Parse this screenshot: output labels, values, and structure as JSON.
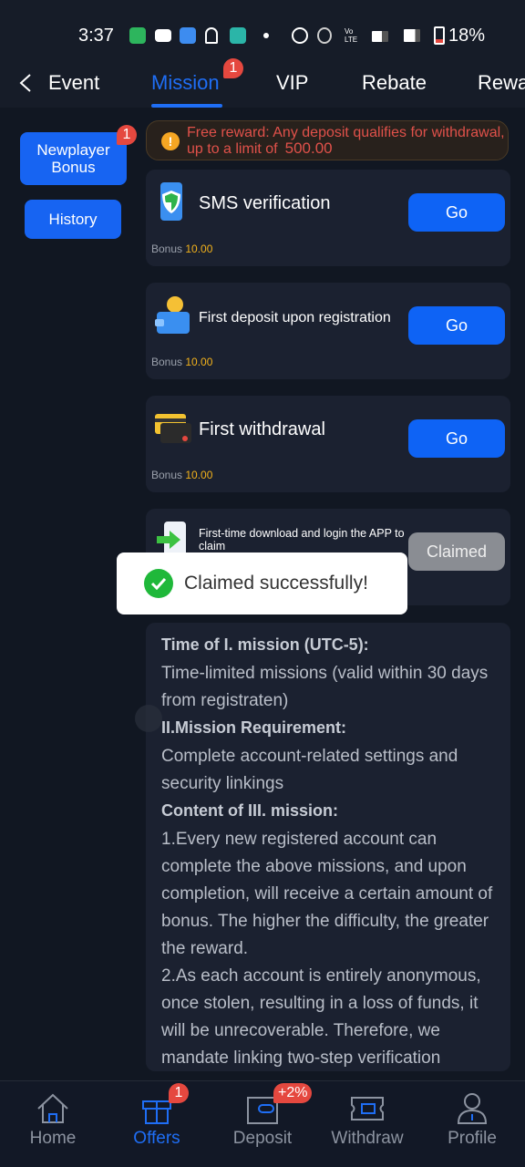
{
  "status_bar": {
    "time": "3:37",
    "battery": "18%",
    "network": "4G"
  },
  "tabs": [
    {
      "label": "Event"
    },
    {
      "label": "Mission",
      "active": true,
      "badge": "1"
    },
    {
      "label": "VIP"
    },
    {
      "label": "Rebate"
    },
    {
      "label": "Rewa"
    }
  ],
  "sidebar": {
    "items": [
      {
        "label": "Newplayer\nBonus",
        "active": true,
        "badge": "1"
      },
      {
        "label": "History"
      }
    ]
  },
  "notice": {
    "text": "Free reward: Any deposit qualifies for withdrawal, up to a limit of",
    "amount": "500.00"
  },
  "missions": [
    {
      "title": "SMS verification",
      "bonus_label": "Bonus",
      "bonus": "10.00",
      "button": "Go",
      "icon": "shield-phone-icon"
    },
    {
      "title": "First deposit upon registration",
      "bonus_label": "Bonus",
      "bonus": "10.00",
      "button": "Go",
      "icon": "wallet-coin-icon"
    },
    {
      "title": "First withdrawal",
      "bonus_label": "Bonus",
      "bonus": "10.00",
      "button": "Go",
      "icon": "cards-icon"
    },
    {
      "title": "First-time download and login the APP to claim",
      "button": "Claimed",
      "icon": "app-download-icon"
    }
  ],
  "toast": {
    "message": "Claimed successfully!"
  },
  "rules": {
    "h1": "Time of I. mission (UTC-5):",
    "p1": "Time-limited missions (valid within 30 days from registraten)",
    "h2": "II.Mission Requirement:",
    "p2": "Complete account-related settings and security linkings",
    "h3": "Content of III. mission:",
    "p3": "1.Every new registered account can complete the above missions, and upon completion, will receive a certain amount of bonus. The higher the difficulty, the greater the reward.",
    "p4": "2.As each account is entirely anonymous, once stolen, resulting in a loss of funds, it will be unrecoverable. Therefore, we mandate linking two-step verification"
  },
  "bottom_nav": [
    {
      "label": "Home"
    },
    {
      "label": "Offers",
      "active": true,
      "badge": "1"
    },
    {
      "label": "Deposit",
      "badge": "+2%"
    },
    {
      "label": "Withdraw"
    },
    {
      "label": "Profile"
    }
  ],
  "colors": {
    "accent": "#1f6ef5",
    "button": "#0e63f5",
    "badge": "#e5483f",
    "bonus": "#f3b21b",
    "notice_text": "#e0514a",
    "success": "#1fb83a"
  }
}
